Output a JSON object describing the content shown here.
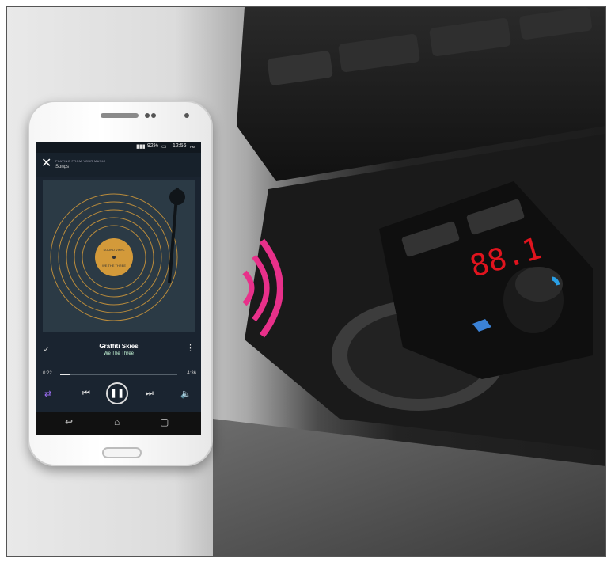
{
  "status": {
    "battery": "92%",
    "time": "12:56",
    "ampm": "PM"
  },
  "header": {
    "close_icon": "close-icon",
    "playing_from": "PLAYING FROM YOUR MUSIC",
    "source": "Songs"
  },
  "record_label": {
    "top": "SOUND VINYL",
    "bottom": "WE THE THREE"
  },
  "track": {
    "title": "Graffiti Skies",
    "artist": "We The Three",
    "elapsed": "0:22",
    "total": "4:36",
    "progress": 0.08
  },
  "display": {
    "readout": "88.1"
  },
  "colors": {
    "accent": "#e8308a",
    "led": "#e0141e",
    "call": "#2aa0e6",
    "bt": "#3b82d6",
    "label": "#d39a3a"
  }
}
